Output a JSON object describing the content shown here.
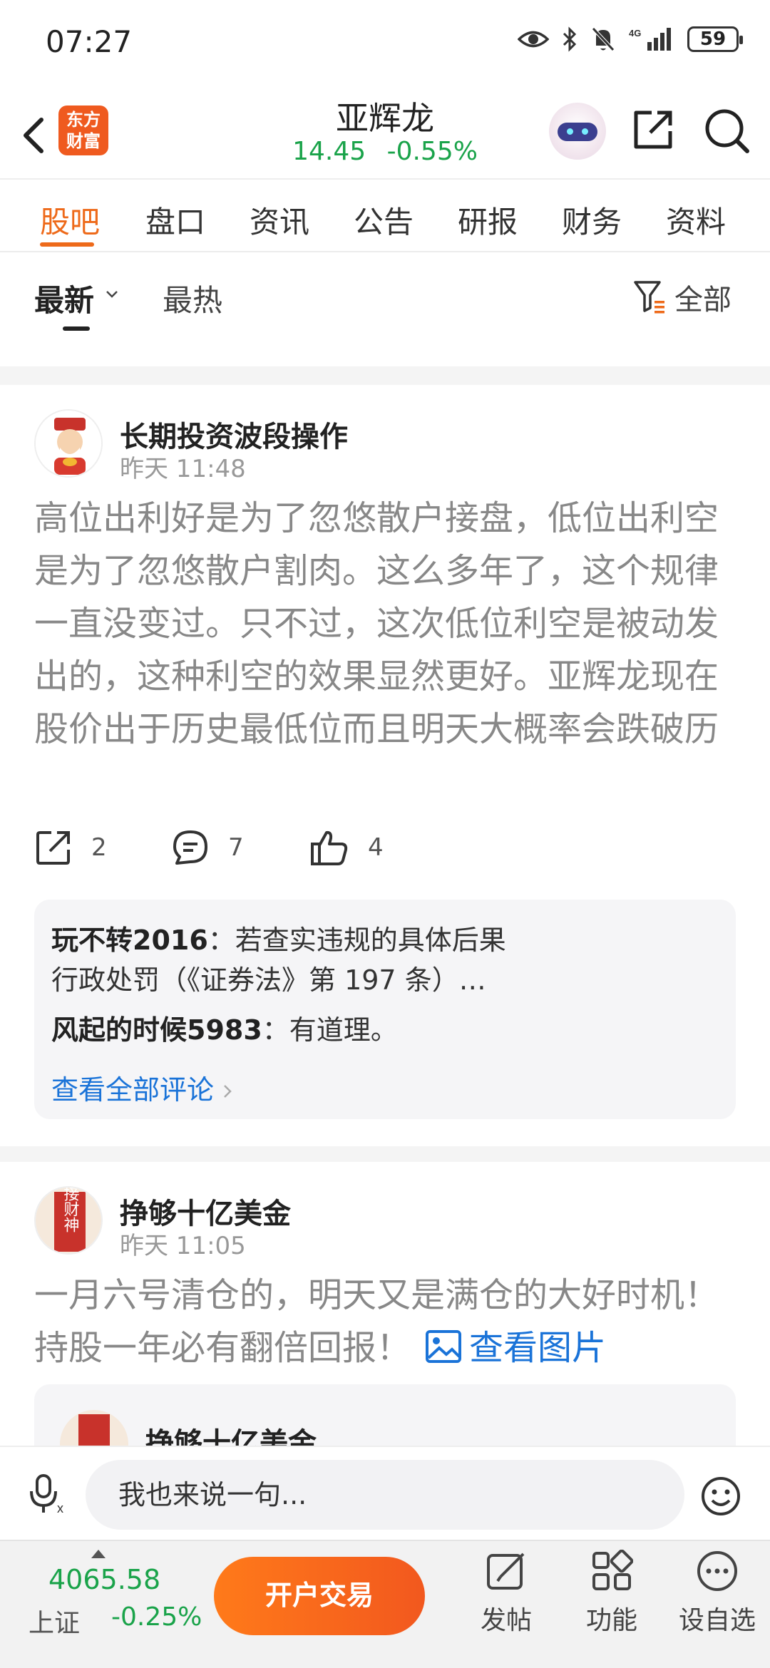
{
  "status_bar": {
    "time": "07:27",
    "network": "4G",
    "battery": "59"
  },
  "header": {
    "logo_text": "东方财富",
    "stock_name": "亚辉龙",
    "price": "14.45",
    "change": "-0.55%",
    "quote_color": "#1aa34a"
  },
  "tabs": [
    {
      "label": "股吧",
      "active": true
    },
    {
      "label": "盘口"
    },
    {
      "label": "资讯"
    },
    {
      "label": "公告"
    },
    {
      "label": "研报"
    },
    {
      "label": "财务"
    },
    {
      "label": "资料"
    }
  ],
  "sort": {
    "latest": "最新",
    "hot": "最热",
    "filter": "全部"
  },
  "posts": [
    {
      "author": "长期投资波段操作",
      "time": "昨天 11:48",
      "text": "高位出利好是为了忽悠散户接盘，低位出利空是为了忽悠散户割肉。这么多年了，这个规律一直没变过。只不过，这次低位利空是被动发出的，这种利空的效果显然更好。亚辉龙现在股价出于历史最低位而且明天大概率会跌破历史最低位，是割肉还是抄底？…",
      "shares": "2",
      "comments": "7",
      "likes": "4",
      "replies": [
        {
          "name": "玩不转2016",
          "text": "：若查实违规的具体后果",
          "text2": "行政处罚（《证券法》第 197 条）…"
        },
        {
          "name": "风起的时候5983",
          "text": "：有道理。"
        }
      ],
      "view_all": "查看全部评论"
    },
    {
      "author": "挣够十亿美金",
      "time": "昨天 11:05",
      "text": "一月六号清仓的，明天又是满仓的大好时机！持股一年必有翻倍回报！",
      "view_image": "查看图片",
      "quoted_author": "挣够十亿美金",
      "avatar_text": "接财神"
    }
  ],
  "input": {
    "placeholder": "我也来说一句..."
  },
  "bottom": {
    "index_value": "4065.58",
    "index_name": "上证",
    "index_change": "-0.25%",
    "trade_button": "开户交易",
    "post_label": "发帖",
    "function_label": "功能",
    "watchlist_label": "设自选"
  },
  "colors": {
    "accent": "#ee6a1a",
    "link": "#1a73d8",
    "down": "#1aa34a"
  }
}
